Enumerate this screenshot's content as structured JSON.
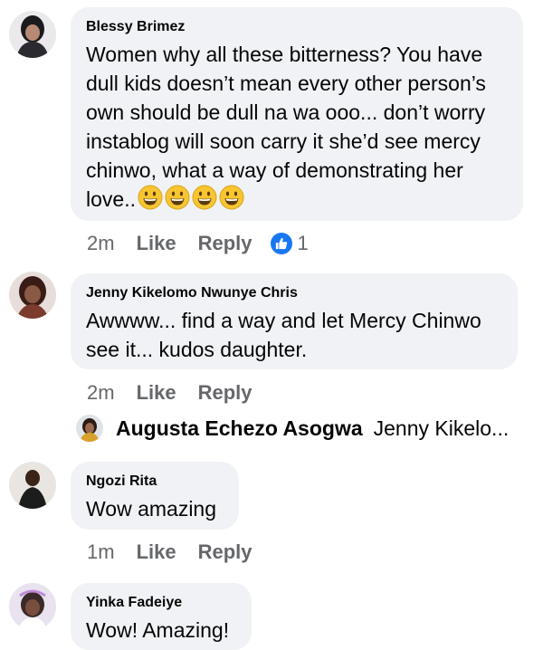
{
  "comments": [
    {
      "author": "Blessy Brimez",
      "text": "Women why all these bitterness? You have dull kids doesn’t mean every other person’s own should be dull na wa ooo... don’t worry instablog will soon carry it she’d see mercy chinwo, what a way of demonstrating her love..",
      "emoji_count": 4,
      "time": "2m",
      "like_label": "Like",
      "reply_label": "Reply",
      "reaction_count": "1"
    },
    {
      "author": "Jenny Kikelomo Nwunye Chris",
      "text": "Awwww... find a way and let Mercy Chinwo see it... kudos daughter.",
      "time": "2m",
      "like_label": "Like",
      "reply_label": "Reply"
    },
    {
      "author": "Ngozi Rita",
      "text": "Wow amazing",
      "time": "1m",
      "like_label": "Like",
      "reply_label": "Reply"
    },
    {
      "author": "Yinka Fadeiye",
      "text": "Wow! Amazing!"
    }
  ],
  "reply_preview": {
    "author": "Augusta Echezo Asogwa",
    "text": "Jenny Kikelo..."
  },
  "icons": {
    "reaction": "like-thumb-icon",
    "emoji": "grinning-face-emoji"
  },
  "colors": {
    "bubble": "#f0f2f5",
    "meta": "#65676b",
    "like_blue": "#1877f2"
  }
}
